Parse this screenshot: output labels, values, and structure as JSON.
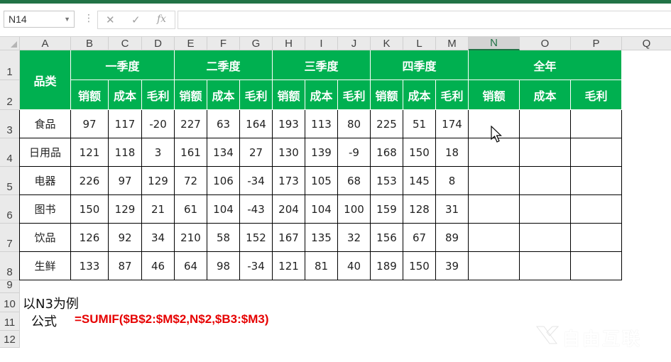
{
  "namebox": {
    "value": "N14"
  },
  "formula_bar": {
    "cancel_icon": "✕",
    "enter_icon": "✓",
    "fx_label": "fx",
    "content": ""
  },
  "columns": [
    "A",
    "B",
    "C",
    "D",
    "E",
    "F",
    "G",
    "H",
    "I",
    "J",
    "K",
    "L",
    "M",
    "N",
    "O",
    "P",
    "Q"
  ],
  "selected_column": "N",
  "rows": [
    "1",
    "2",
    "3",
    "4",
    "5",
    "6",
    "7",
    "8",
    "9",
    "10",
    "11",
    "12"
  ],
  "table": {
    "category_header": "品类",
    "quarters": [
      "一季度",
      "二季度",
      "三季度",
      "四季度",
      "全年"
    ],
    "metrics": [
      "销额",
      "成本",
      "毛利"
    ],
    "data": [
      {
        "name": "食品",
        "values": [
          "97",
          "117",
          "-20",
          "227",
          "63",
          "164",
          "193",
          "113",
          "80",
          "225",
          "51",
          "174"
        ]
      },
      {
        "name": "日用品",
        "values": [
          "121",
          "118",
          "3",
          "161",
          "134",
          "27",
          "130",
          "139",
          "-9",
          "168",
          "150",
          "18"
        ]
      },
      {
        "name": "电器",
        "values": [
          "226",
          "97",
          "129",
          "72",
          "106",
          "-34",
          "173",
          "105",
          "68",
          "153",
          "145",
          "8"
        ]
      },
      {
        "name": "图书",
        "values": [
          "150",
          "129",
          "21",
          "61",
          "104",
          "-43",
          "204",
          "104",
          "100",
          "159",
          "128",
          "31"
        ]
      },
      {
        "name": "饮品",
        "values": [
          "126",
          "92",
          "34",
          "210",
          "58",
          "152",
          "167",
          "135",
          "32",
          "156",
          "67",
          "89"
        ]
      },
      {
        "name": "生鲜",
        "values": [
          "133",
          "87",
          "46",
          "64",
          "98",
          "-34",
          "121",
          "81",
          "40",
          "189",
          "150",
          "39"
        ]
      }
    ]
  },
  "note": "以N3为例",
  "formula_label": "公式",
  "formula": "=SUMIF($B$2:$M$2,N$2,$B3:$M3)",
  "watermark": "自由互联",
  "colors": {
    "header_green": "#00b050",
    "excel_green": "#217346",
    "formula_red": "#e60000"
  }
}
